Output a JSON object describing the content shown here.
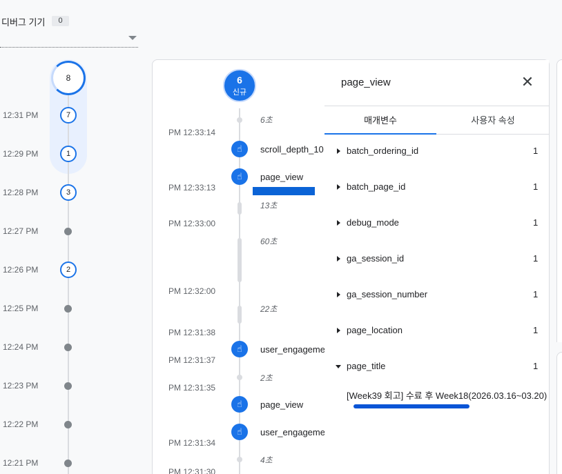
{
  "device": {
    "label": "디버그 기기",
    "count": "0"
  },
  "minutes": {
    "current_count": "8",
    "rows": [
      {
        "time": "12:31 PM",
        "count": "7"
      },
      {
        "time": "12:29 PM",
        "count": "1"
      },
      {
        "time": "12:28 PM",
        "count": "3"
      },
      {
        "time": "12:27 PM",
        "count": ""
      },
      {
        "time": "12:26 PM",
        "count": "2"
      },
      {
        "time": "12:25 PM",
        "count": ""
      },
      {
        "time": "12:24 PM",
        "count": ""
      },
      {
        "time": "12:23 PM",
        "count": ""
      },
      {
        "time": "12:22 PM",
        "count": ""
      },
      {
        "time": "12:21 PM",
        "count": ""
      }
    ]
  },
  "stream": {
    "new_count": "6",
    "new_label": "신규",
    "gaps": [
      "6초",
      "13초",
      "60초",
      "22초",
      "2초",
      "4초"
    ],
    "times": [
      "PM 12:33:14",
      "PM 12:33:13",
      "PM 12:33:00",
      "PM 12:32:00",
      "PM 12:31:38",
      "PM 12:31:37",
      "PM 12:31:35",
      "PM 12:31:34",
      "PM 12:31:30"
    ],
    "events": [
      "scroll_depth_10",
      "page_view",
      "user_engagement",
      "page_view",
      "user_engagement"
    ]
  },
  "panel": {
    "title": "page_view",
    "tabs": [
      "매개변수",
      "사용자 속성"
    ],
    "params": [
      {
        "name": "batch_ordering_id",
        "count": "1"
      },
      {
        "name": "batch_page_id",
        "count": "1"
      },
      {
        "name": "debug_mode",
        "count": "1"
      },
      {
        "name": "ga_session_id",
        "count": "1"
      },
      {
        "name": "ga_session_number",
        "count": "1"
      },
      {
        "name": "page_location",
        "count": "1"
      },
      {
        "name": "page_title",
        "count": "1"
      }
    ],
    "page_title_value": "[Week39 회고] 수료 후 Week18(2026.03.16~03.20)"
  },
  "colors": {
    "accent": "#1a73e8",
    "highlight": "#e8f0fe",
    "annotation": "#0b55d6"
  }
}
